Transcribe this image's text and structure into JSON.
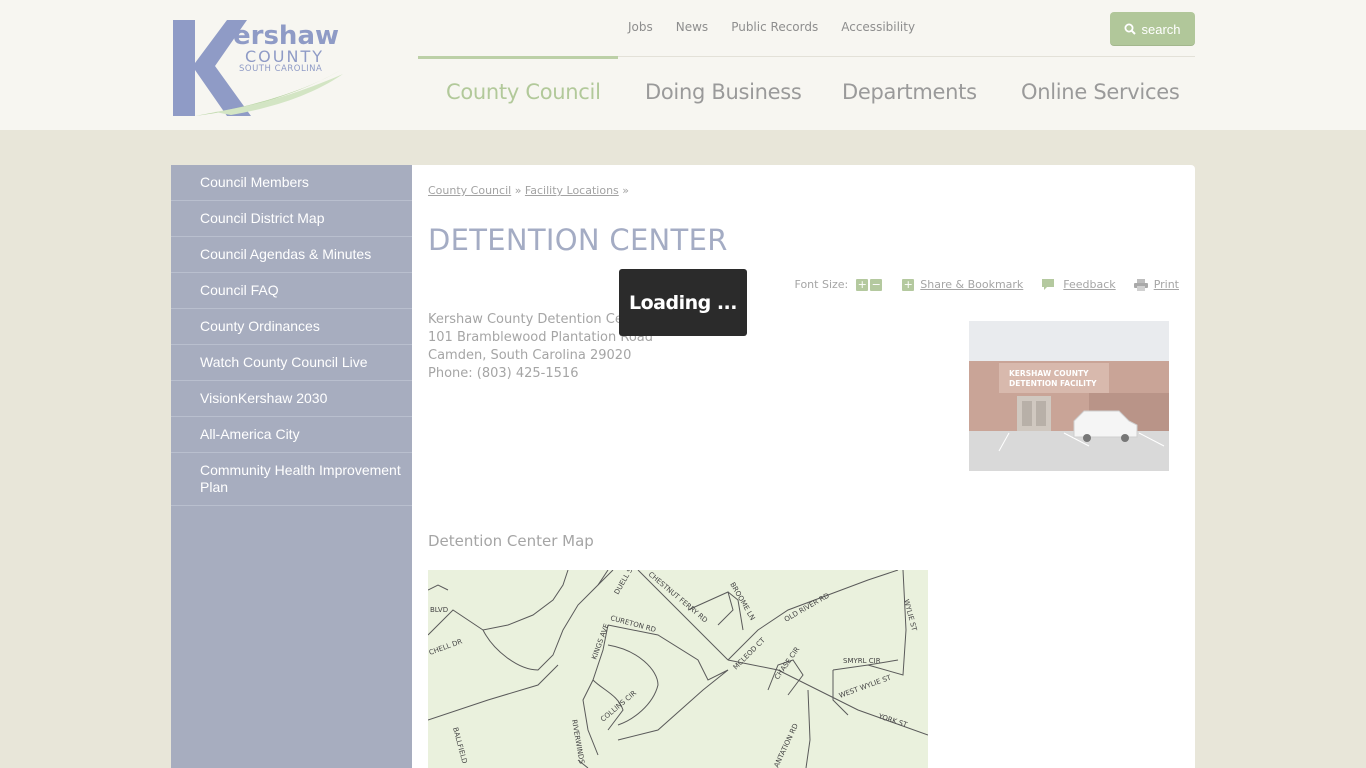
{
  "logo": {
    "line1": "ershaw",
    "line2": "COUNTY",
    "line3": "SOUTH CAROLINA",
    "initial": "K"
  },
  "utility": [
    "Jobs",
    "News",
    "Public Records",
    "Accessibility"
  ],
  "search_label": "search",
  "nav": [
    "County Council",
    "Doing Business",
    "Departments",
    "Online Services"
  ],
  "nav_active": "County Council",
  "sidebar": [
    "Council Members",
    "Council District Map",
    "Council Agendas & Minutes",
    "Council FAQ",
    "County Ordinances",
    "Watch County Council Live",
    "VisionKershaw 2030",
    "All-America City",
    "Community Health Improvement Plan"
  ],
  "breadcrumb": {
    "item1": "County Council",
    "sep": "»",
    "item2": "Facility Locations"
  },
  "title": "DETENTION CENTER",
  "tools": {
    "font_size": "Font Size:",
    "share": "Share & Bookmark",
    "feedback": "Feedback",
    "print": "Print"
  },
  "address": {
    "name": "Kershaw County Detention Center",
    "street": "101 Bramblewood Plantation Road",
    "city": "Camden, South Carolina 29020",
    "phone": "Phone: (803) 425-1516"
  },
  "photo_sign": [
    "KERSHAW COUNTY",
    "DETENTION FACILITY"
  ],
  "map_heading": "Detention Center Map",
  "map_labels": [
    "BLVD",
    "CHELL DR",
    "DUELL ST",
    "CHESTNUT FERRY RD",
    "BROOME LN",
    "OLD RIVER RD",
    "WYLIE ST",
    "CURETON RD",
    "KINGS AVE",
    "MCLEOD CT",
    "CHASE CIR",
    "SMYRL CIR",
    "WEST WYLIE ST",
    "YORK ST",
    "COLLINS CIR",
    "RIVERWINDS",
    "BALLFIELD",
    "ANTATION RD"
  ],
  "loading": "Loading ...",
  "colors": {
    "accent_green": "#b2c99a",
    "sidebar_bg": "#a7adbf",
    "title": "#a4acc4"
  }
}
